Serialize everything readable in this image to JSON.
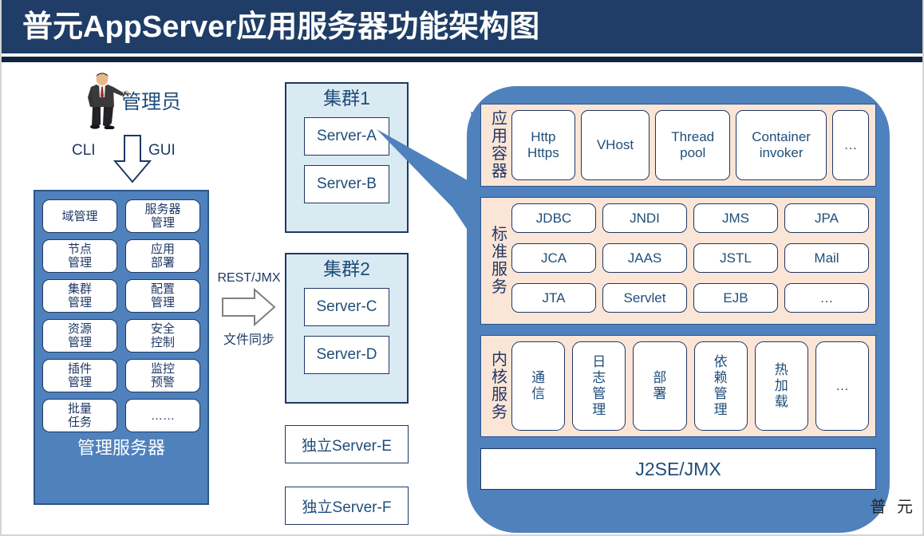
{
  "header": {
    "title": "普元AppServer应用服务器功能架构图"
  },
  "admin": {
    "icon": "businessman-icon",
    "label": "管理员"
  },
  "cli_gui_arrow": {
    "left_label": "CLI",
    "right_label": "GUI",
    "icon": "down-arrow-icon"
  },
  "management_server": {
    "footer_title": "管理服务器",
    "items": [
      "域管理",
      "服务器\n管理",
      "节点\n管理",
      "应用\n部署",
      "集群\n管理",
      "配置\n管理",
      "资源\n管理",
      "安全\n控制",
      "插件\n管理",
      "监控\n预警",
      "批量\n任务",
      "……"
    ]
  },
  "rest_arrow": {
    "top_label": "REST/JMX",
    "bottom_label": "文件同步",
    "icon": "right-arrow-icon"
  },
  "clusters": [
    {
      "title": "集群1",
      "servers": [
        "Server-A",
        "Server-B"
      ]
    },
    {
      "title": "集群2",
      "servers": [
        "Server-C",
        "Server-D"
      ]
    }
  ],
  "standalone_servers": [
    "独立Server-E",
    "独立Server-F"
  ],
  "server_detail": {
    "layers": [
      {
        "label": "应用容器",
        "items": [
          "Http\nHttps",
          "VHost",
          "Thread\npool",
          "Container\ninvoker",
          "…"
        ]
      },
      {
        "label": "标准服务",
        "items": [
          "JDBC",
          "JNDI",
          "JMS",
          "JPA",
          "JCA",
          "JAAS",
          "JSTL",
          "Mail",
          "JTA",
          "Servlet",
          "EJB",
          "…"
        ]
      },
      {
        "label": "内核服务",
        "items": [
          "通信",
          "日志管理",
          "部署",
          "依赖管理",
          "热加载",
          "…"
        ]
      }
    ],
    "base_bar": "J2SE/JMX"
  },
  "watermark": "普 元",
  "colors": {
    "title_bar": "#1f3d66",
    "title_rule": "#10233f",
    "panel_blue": "#4f81bd",
    "panel_border": "#2b5589",
    "cluster_fill": "#daeaf3",
    "layer_fill": "#fbe5d6",
    "text_navy": "#1f3864",
    "text_blue": "#1f4e79"
  }
}
